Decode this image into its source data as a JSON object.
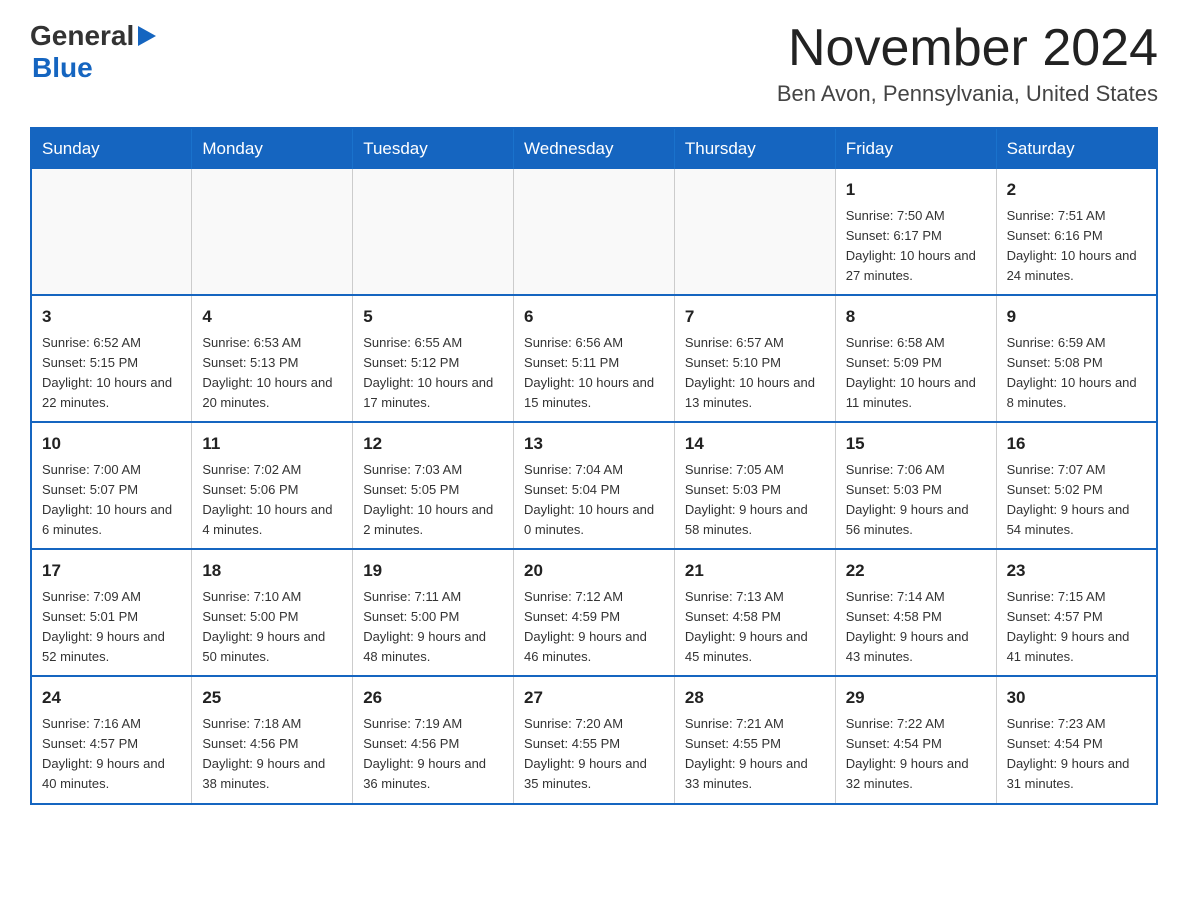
{
  "header": {
    "logo_general": "General",
    "logo_blue": "Blue",
    "title": "November 2024",
    "location": "Ben Avon, Pennsylvania, United States"
  },
  "days_of_week": [
    "Sunday",
    "Monday",
    "Tuesday",
    "Wednesday",
    "Thursday",
    "Friday",
    "Saturday"
  ],
  "weeks": [
    [
      {
        "day": "",
        "info": ""
      },
      {
        "day": "",
        "info": ""
      },
      {
        "day": "",
        "info": ""
      },
      {
        "day": "",
        "info": ""
      },
      {
        "day": "",
        "info": ""
      },
      {
        "day": "1",
        "info": "Sunrise: 7:50 AM\nSunset: 6:17 PM\nDaylight: 10 hours and 27 minutes."
      },
      {
        "day": "2",
        "info": "Sunrise: 7:51 AM\nSunset: 6:16 PM\nDaylight: 10 hours and 24 minutes."
      }
    ],
    [
      {
        "day": "3",
        "info": "Sunrise: 6:52 AM\nSunset: 5:15 PM\nDaylight: 10 hours and 22 minutes."
      },
      {
        "day": "4",
        "info": "Sunrise: 6:53 AM\nSunset: 5:13 PM\nDaylight: 10 hours and 20 minutes."
      },
      {
        "day": "5",
        "info": "Sunrise: 6:55 AM\nSunset: 5:12 PM\nDaylight: 10 hours and 17 minutes."
      },
      {
        "day": "6",
        "info": "Sunrise: 6:56 AM\nSunset: 5:11 PM\nDaylight: 10 hours and 15 minutes."
      },
      {
        "day": "7",
        "info": "Sunrise: 6:57 AM\nSunset: 5:10 PM\nDaylight: 10 hours and 13 minutes."
      },
      {
        "day": "8",
        "info": "Sunrise: 6:58 AM\nSunset: 5:09 PM\nDaylight: 10 hours and 11 minutes."
      },
      {
        "day": "9",
        "info": "Sunrise: 6:59 AM\nSunset: 5:08 PM\nDaylight: 10 hours and 8 minutes."
      }
    ],
    [
      {
        "day": "10",
        "info": "Sunrise: 7:00 AM\nSunset: 5:07 PM\nDaylight: 10 hours and 6 minutes."
      },
      {
        "day": "11",
        "info": "Sunrise: 7:02 AM\nSunset: 5:06 PM\nDaylight: 10 hours and 4 minutes."
      },
      {
        "day": "12",
        "info": "Sunrise: 7:03 AM\nSunset: 5:05 PM\nDaylight: 10 hours and 2 minutes."
      },
      {
        "day": "13",
        "info": "Sunrise: 7:04 AM\nSunset: 5:04 PM\nDaylight: 10 hours and 0 minutes."
      },
      {
        "day": "14",
        "info": "Sunrise: 7:05 AM\nSunset: 5:03 PM\nDaylight: 9 hours and 58 minutes."
      },
      {
        "day": "15",
        "info": "Sunrise: 7:06 AM\nSunset: 5:03 PM\nDaylight: 9 hours and 56 minutes."
      },
      {
        "day": "16",
        "info": "Sunrise: 7:07 AM\nSunset: 5:02 PM\nDaylight: 9 hours and 54 minutes."
      }
    ],
    [
      {
        "day": "17",
        "info": "Sunrise: 7:09 AM\nSunset: 5:01 PM\nDaylight: 9 hours and 52 minutes."
      },
      {
        "day": "18",
        "info": "Sunrise: 7:10 AM\nSunset: 5:00 PM\nDaylight: 9 hours and 50 minutes."
      },
      {
        "day": "19",
        "info": "Sunrise: 7:11 AM\nSunset: 5:00 PM\nDaylight: 9 hours and 48 minutes."
      },
      {
        "day": "20",
        "info": "Sunrise: 7:12 AM\nSunset: 4:59 PM\nDaylight: 9 hours and 46 minutes."
      },
      {
        "day": "21",
        "info": "Sunrise: 7:13 AM\nSunset: 4:58 PM\nDaylight: 9 hours and 45 minutes."
      },
      {
        "day": "22",
        "info": "Sunrise: 7:14 AM\nSunset: 4:58 PM\nDaylight: 9 hours and 43 minutes."
      },
      {
        "day": "23",
        "info": "Sunrise: 7:15 AM\nSunset: 4:57 PM\nDaylight: 9 hours and 41 minutes."
      }
    ],
    [
      {
        "day": "24",
        "info": "Sunrise: 7:16 AM\nSunset: 4:57 PM\nDaylight: 9 hours and 40 minutes."
      },
      {
        "day": "25",
        "info": "Sunrise: 7:18 AM\nSunset: 4:56 PM\nDaylight: 9 hours and 38 minutes."
      },
      {
        "day": "26",
        "info": "Sunrise: 7:19 AM\nSunset: 4:56 PM\nDaylight: 9 hours and 36 minutes."
      },
      {
        "day": "27",
        "info": "Sunrise: 7:20 AM\nSunset: 4:55 PM\nDaylight: 9 hours and 35 minutes."
      },
      {
        "day": "28",
        "info": "Sunrise: 7:21 AM\nSunset: 4:55 PM\nDaylight: 9 hours and 33 minutes."
      },
      {
        "day": "29",
        "info": "Sunrise: 7:22 AM\nSunset: 4:54 PM\nDaylight: 9 hours and 32 minutes."
      },
      {
        "day": "30",
        "info": "Sunrise: 7:23 AM\nSunset: 4:54 PM\nDaylight: 9 hours and 31 minutes."
      }
    ]
  ]
}
